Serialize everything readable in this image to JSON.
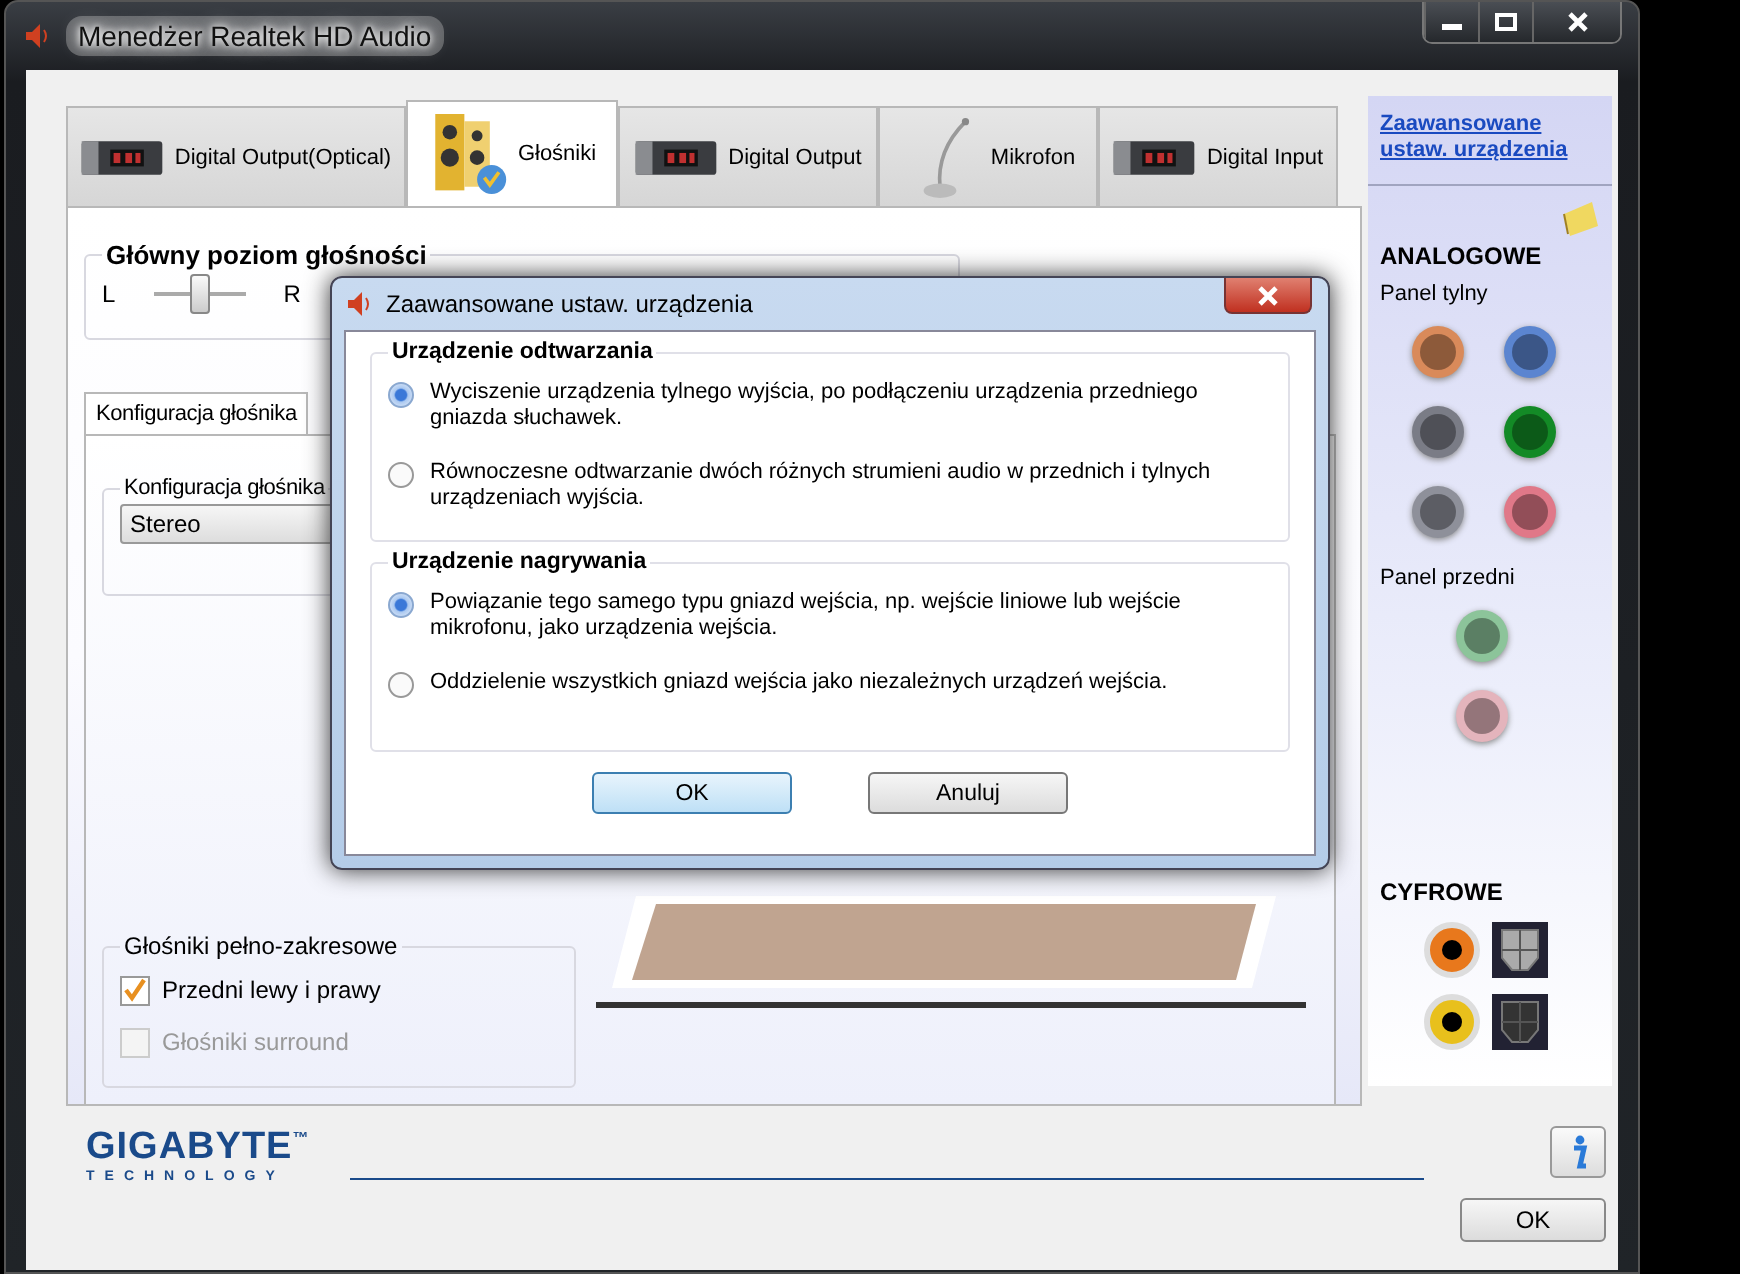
{
  "window": {
    "title": "Menedżer Realtek HD Audio"
  },
  "tabs": [
    {
      "label": "Digital Output(Optical)",
      "kind": "device",
      "selected": false
    },
    {
      "label": "Głośniki",
      "kind": "speakers",
      "selected": true
    },
    {
      "label": "Digital Output",
      "kind": "device",
      "selected": false
    },
    {
      "label": "Mikrofon",
      "kind": "mic",
      "selected": false
    },
    {
      "label": "Digital Input",
      "kind": "device",
      "selected": false
    }
  ],
  "volume": {
    "title": "Główny poziom głośności",
    "left": "L",
    "right": "R",
    "level": 0.5
  },
  "subtabs": [
    {
      "label": "Konfiguracja głośnika",
      "selected": true
    }
  ],
  "speaker_config": {
    "title": "Konfiguracja głośnika",
    "value": "Stereo"
  },
  "full_range": {
    "title": "Głośniki pełno-zakresowe",
    "options": [
      {
        "label": "Przedni lewy i prawy",
        "checked": true,
        "disabled": false
      },
      {
        "label": "Głośniki surround",
        "checked": false,
        "disabled": true
      }
    ]
  },
  "sidebar": {
    "link": "Zaawansowane ustaw. urządzenia",
    "analog_title": "ANALOGOWE",
    "rear_title": "Panel tylny",
    "rear_jacks": [
      {
        "color": "#d98a5a"
      },
      {
        "color": "#5b85d0"
      },
      {
        "color": "#7a7c86"
      },
      {
        "color": "#138a26"
      },
      {
        "color": "#8e909a"
      },
      {
        "color": "#e07888"
      }
    ],
    "front_title": "Panel przedni",
    "front_jacks": [
      {
        "color": "#8cc49a"
      },
      {
        "color": "#e4b4bc"
      }
    ],
    "digital_title": "CYFROWE",
    "digital_jacks": [
      {
        "color": "#e8781c"
      },
      {
        "color": "#e8c01c"
      }
    ]
  },
  "brand": {
    "name": "GIGABYTE",
    "mark": "™",
    "sub": "TECHNOLOGY"
  },
  "ok_button": "OK",
  "dialog": {
    "title": "Zaawansowane ustaw. urządzenia",
    "groups": [
      {
        "title": "Urządzenie odtwarzania",
        "options": [
          {
            "label": "Wyciszenie urządzenia tylnego wyjścia, po podłączeniu urządzenia przedniego gniazda słuchawek.",
            "selected": true
          },
          {
            "label": "Równoczesne odtwarzanie dwóch różnych strumieni audio w przednich i tylnych urządzeniach wyjścia.",
            "selected": false
          }
        ]
      },
      {
        "title": "Urządzenie nagrywania",
        "options": [
          {
            "label": "Powiązanie tego samego typu gniazd wejścia, np. wejście liniowe lub wejście mikrofonu, jako urządzenia wejścia.",
            "selected": true
          },
          {
            "label": "Oddzielenie wszystkich gniazd wejścia jako niezależnych urządzeń wejścia.",
            "selected": false
          }
        ]
      }
    ],
    "buttons": [
      {
        "label": "OK",
        "default": true
      },
      {
        "label": "Anuluj",
        "default": false
      }
    ]
  }
}
